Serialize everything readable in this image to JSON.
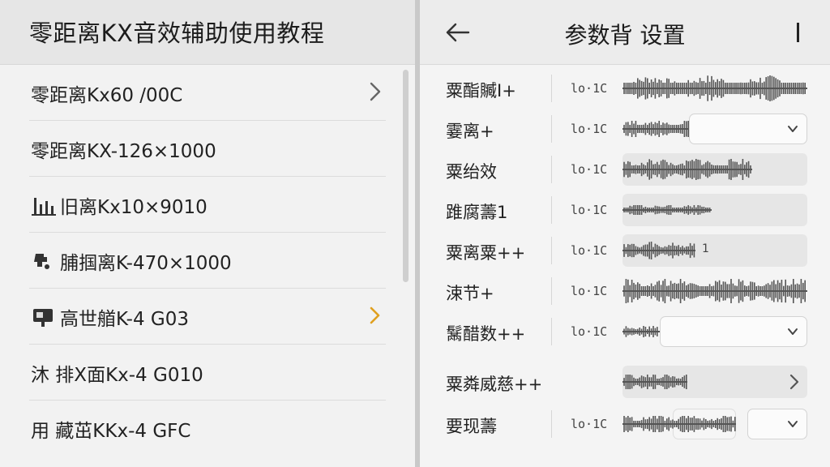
{
  "left": {
    "title": "零距离KX音效辅助使用教程",
    "items": [
      {
        "label": "零距离Kx60 /00C",
        "icon": "",
        "chevron": "gray"
      },
      {
        "label": "零距离KX-126×1000",
        "icon": "",
        "chevron": ""
      },
      {
        "label": "旧离Kx10×9010",
        "icon": "bars-icon",
        "chevron": ""
      },
      {
        "label": "脯掴离K-470×1000",
        "icon": "puzzle-icon",
        "chevron": ""
      },
      {
        "label": "高世艏K-4 G03",
        "icon": "monitor-icon",
        "chevron": "yellow"
      },
      {
        "label": "沐 排X面Kx-4 G010",
        "icon": "",
        "chevron": ""
      },
      {
        "label": "用 藏茁KKx-4 GFC",
        "icon": "",
        "chevron": ""
      }
    ]
  },
  "right": {
    "title": "参数背 设置",
    "rows": [
      {
        "label": "粟酯贓I+",
        "value": "lo·1C",
        "control": "wave"
      },
      {
        "label": "霎离+",
        "value": "lo·1C",
        "control": "wave-dropdown"
      },
      {
        "label": "粟绐效",
        "value": "lo·1C",
        "control": "wave"
      },
      {
        "label": "踓腐薵1",
        "value": "lo·1C",
        "control": "wave"
      },
      {
        "label": "粟离粟++",
        "value": "lo·1C",
        "control": "wave",
        "mark": "1"
      },
      {
        "label": "涑节+",
        "value": "lo·1C",
        "control": "wave"
      },
      {
        "label": "鬗醋数++",
        "value": "lo·1C",
        "control": "wave-dropdown"
      },
      {
        "label": "粟粦威慈++",
        "value": "",
        "control": "wave-chevron"
      },
      {
        "label": "要现薵",
        "value": "lo·1C",
        "control": "wave-dropdown-box"
      }
    ]
  },
  "colors": {
    "accent_chevron": "#e0a020",
    "waveform": "#555555"
  }
}
